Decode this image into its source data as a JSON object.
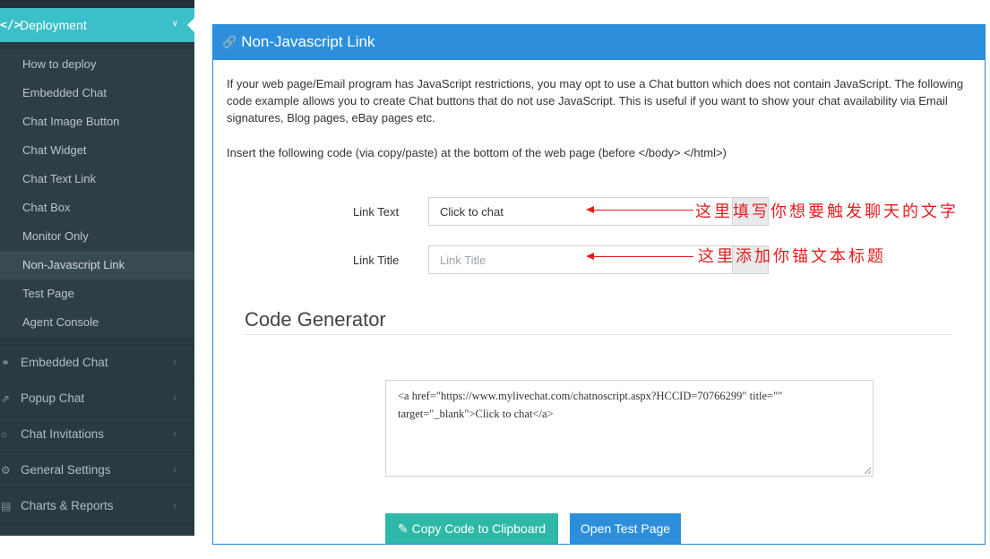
{
  "sidebar": {
    "active": {
      "icon": "code-icon",
      "icon_glyph": "</>",
      "label": "Deployment"
    },
    "sub_items": [
      "How to deploy",
      "Embedded Chat",
      "Chat Image Button",
      "Chat Widget",
      "Chat Text Link",
      "Chat Box",
      "Monitor Only",
      "Non-Javascript Link",
      "Test Page",
      "Agent Console"
    ],
    "current_item": "Non-Javascript Link",
    "groups": [
      {
        "label": "Embedded Chat",
        "icon": "chat-bubbles-icon"
      },
      {
        "label": "Popup Chat",
        "icon": "external-link-icon"
      },
      {
        "label": "Chat Invitations",
        "icon": "speech-bubble-icon"
      },
      {
        "label": "General Settings",
        "icon": "gears-icon"
      },
      {
        "label": "Charts & Reports",
        "icon": "bar-chart-icon"
      }
    ]
  },
  "panel": {
    "title": "Non-Javascript Link",
    "icon": "link-icon",
    "description": "If your web page/Email program has JavaScript restrictions, you may opt to use a Chat button which does not contain JavaScript. The following code example allows you to create Chat buttons that do not use JavaScript. This is useful if you want to show your chat availability via Email signatures, Blog pages, eBay pages etc.",
    "instruction": "Insert the following code (via copy/paste) at the bottom of the web page (before </body> </html>)"
  },
  "form": {
    "link_text_label": "Link Text",
    "link_text_value": "Click to chat",
    "link_title_label": "Link Title",
    "link_title_placeholder": "Link Title"
  },
  "annotations": {
    "text_note": "这里填写你想要触发聊天的文字",
    "title_note": "这里添加你锚文本标题"
  },
  "code_generator": {
    "title": "Code Generator",
    "code": "<a href=\"https://www.mylivechat.com/chatnoscript.aspx?HCCID=70766299\" title=\"\" target=\"_blank\">Click to chat</a>"
  },
  "buttons": {
    "copy": "Copy Code to Clipboard",
    "open": "Open Test Page"
  },
  "colors": {
    "sidebar_bg": "#2b3a42",
    "active_teal": "#3bbfc9",
    "panel_blue": "#2d8fdb",
    "copy_button": "#2fb8a8",
    "annotation_red": "#e21d1d"
  }
}
